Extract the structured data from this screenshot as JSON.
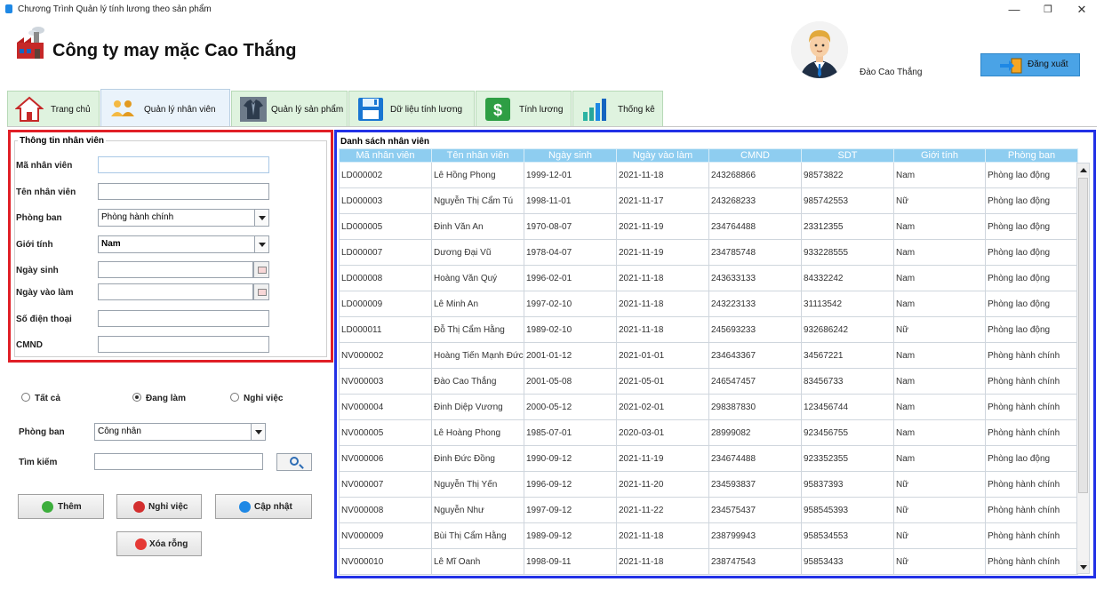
{
  "window": {
    "title": "Chương Trình Quản lý tính lương theo sản phẩm",
    "minimize": "—",
    "maximize": "❐",
    "close": "✕"
  },
  "header": {
    "company_name": "Công ty may mặc Cao Thắng",
    "user_name": "Đào Cao Thắng",
    "logout_label": "Đăng xuất"
  },
  "tabs": [
    {
      "label": "Trang chủ",
      "icon": "home-icon"
    },
    {
      "label": "Quản lý nhân viên",
      "icon": "users-icon"
    },
    {
      "label": "Quản lý sản phẩm",
      "icon": "shirt-icon"
    },
    {
      "label": "Dữ liệu tính lương",
      "icon": "floppy-icon"
    },
    {
      "label": "Tính lương",
      "icon": "dollar-icon"
    },
    {
      "label": "Thống kê",
      "icon": "bar-chart-icon"
    }
  ],
  "active_tab": "Quản lý nhân viên",
  "employee_form": {
    "legend": "Thông tin nhân viên",
    "fields": {
      "ma_nv": {
        "label": "Mã nhân viên",
        "value": ""
      },
      "ten_nv": {
        "label": "Tên nhân viên",
        "value": ""
      },
      "phong_ban": {
        "label": "Phòng ban",
        "value": "Phòng hành chính"
      },
      "gioi_tinh": {
        "label": "Giới tính",
        "value": "Nam"
      },
      "ngay_sinh": {
        "label": "Ngày sinh",
        "value": ""
      },
      "ngay_vao_lam": {
        "label": "Ngày vào làm",
        "value": ""
      },
      "so_dien_thoai": {
        "label": "Số điện thoại",
        "value": ""
      },
      "cmnd": {
        "label": "CMND",
        "value": ""
      }
    }
  },
  "filter": {
    "radio_all": "Tất cả",
    "radio_working": "Đang làm",
    "radio_quit": "Nghỉ việc",
    "selected": "Đang làm",
    "department_label": "Phòng ban",
    "department_value": "Công nhân",
    "search_label": "Tìm kiếm",
    "search_value": ""
  },
  "actions": {
    "add": "Thêm",
    "quit": "Nghỉ việc",
    "update": "Cập nhật",
    "clear": "Xóa rỗng"
  },
  "list": {
    "legend": "Danh sách nhân viên",
    "columns": [
      "Mã nhân viên",
      "Tên nhân viên",
      "Ngày sinh",
      "Ngày vào làm",
      "CMND",
      "SDT",
      "Giới tính",
      "Phòng ban"
    ],
    "rows": [
      [
        "LD000002",
        "Lê Hồng Phong",
        "1999-12-01",
        "2021-11-18",
        "243268866",
        "98573822",
        "Nam",
        "Phòng lao động"
      ],
      [
        "LD000003",
        "Nguyễn Thị Cẩm Tú",
        "1998-11-01",
        "2021-11-17",
        "243268233",
        "985742553",
        "Nữ",
        "Phòng lao động"
      ],
      [
        "LD000005",
        "Đinh Văn An",
        "1970-08-07",
        "2021-11-19",
        "234764488",
        "23312355",
        "Nam",
        "Phòng lao động"
      ],
      [
        "LD000007",
        "Dương Đại Vũ",
        "1978-04-07",
        "2021-11-19",
        "234785748",
        "933228555",
        "Nam",
        "Phòng lao động"
      ],
      [
        "LD000008",
        "Hoàng Văn Quý",
        "1996-02-01",
        "2021-11-18",
        "243633133",
        "84332242",
        "Nam",
        "Phòng lao động"
      ],
      [
        "LD000009",
        "Lê Minh An",
        "1997-02-10",
        "2021-11-18",
        "243223133",
        "31113542",
        "Nam",
        "Phòng lao động"
      ],
      [
        "LD000011",
        "Đỗ Thị Cẩm Hằng",
        "1989-02-10",
        "2021-11-18",
        "245693233",
        "932686242",
        "Nữ",
        "Phòng lao động"
      ],
      [
        "NV000002",
        "Hoàng Tiến Mạnh Đức",
        "2001-01-12",
        "2021-01-01",
        "234643367",
        "34567221",
        "Nam",
        "Phòng hành chính"
      ],
      [
        "NV000003",
        "Đào Cao Thắng",
        "2001-05-08",
        "2021-05-01",
        "246547457",
        "83456733",
        "Nam",
        "Phòng hành chính"
      ],
      [
        "NV000004",
        "Đinh Diệp Vương",
        "2000-05-12",
        "2021-02-01",
        "298387830",
        "123456744",
        "Nam",
        "Phòng hành chính"
      ],
      [
        "NV000005",
        "Lê Hoàng Phong",
        "1985-07-01",
        "2020-03-01",
        "28999082",
        "923456755",
        "Nam",
        "Phòng hành chính"
      ],
      [
        "NV000006",
        "Đinh Đức Đồng",
        "1990-09-12",
        "2021-11-19",
        "234674488",
        "923352355",
        "Nam",
        "Phòng lao động"
      ],
      [
        "NV000007",
        "Nguyễn Thị Yến",
        "1996-09-12",
        "2021-11-20",
        "234593837",
        "95837393",
        "Nữ",
        "Phòng hành chính"
      ],
      [
        "NV000008",
        "Nguyễn Như",
        "1997-09-12",
        "2021-11-22",
        "234575437",
        "958545393",
        "Nữ",
        "Phòng hành chính"
      ],
      [
        "NV000009",
        "Bùi Thị Cẩm Hằng",
        "1989-09-12",
        "2021-11-18",
        "238799943",
        "958534553",
        "Nữ",
        "Phòng hành chính"
      ],
      [
        "NV000010",
        "Lê Mĩ Oanh",
        "1998-09-11",
        "2021-11-18",
        "238747543",
        "95853433",
        "Nữ",
        "Phòng hành chính"
      ]
    ]
  },
  "colors": {
    "info_border": "#e01f26",
    "list_border": "#2231e6",
    "grid_header": "#8ecdf0",
    "logout_bg": "#4aa3e6"
  }
}
